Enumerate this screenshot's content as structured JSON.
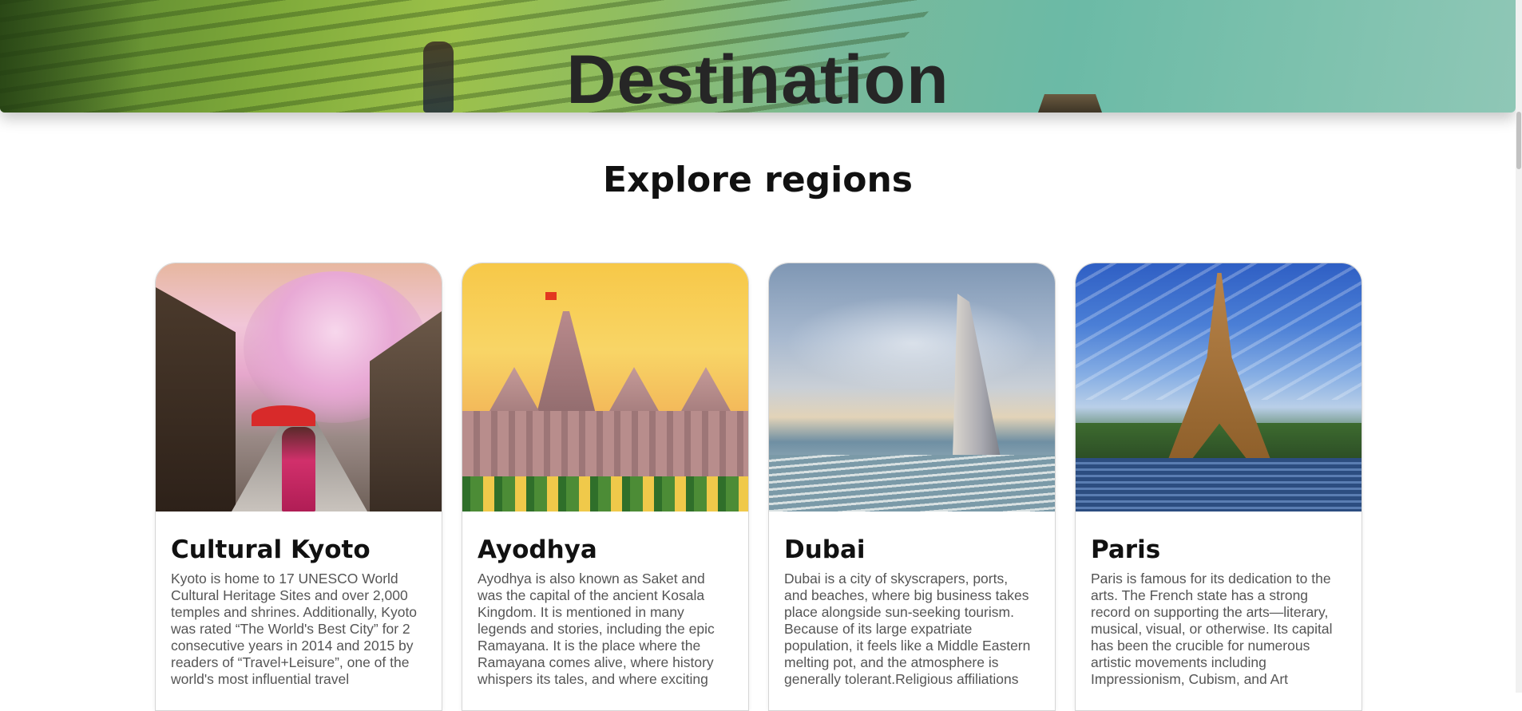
{
  "hero": {
    "title": "Destination"
  },
  "section": {
    "title": "Explore regions"
  },
  "cards": [
    {
      "title": "Cultural Kyoto",
      "image": "kyoto-street-cherry-blossom",
      "desc_lines": [
        "Kyoto is home to 17 UNESCO World",
        "Cultural Heritage Sites and over 2,000",
        "temples and shrines. Additionally, Kyoto",
        "was rated “The World's Best City” for 2",
        "consecutive years in 2014 and 2015 by",
        "readers of “Travel+Leisure”, one of the",
        "world's most influential travel"
      ]
    },
    {
      "title": "Ayodhya",
      "image": "ayodhya-ram-temple",
      "desc_lines": [
        "Ayodhya is also known as Saket and",
        "was the capital of the ancient Kosala",
        "Kingdom. It is mentioned in many",
        "legends and stories, including the epic",
        "Ramayana. It is the place where the",
        "Ramayana comes alive, where history",
        "whispers its tales, and where exciting"
      ]
    },
    {
      "title": "Dubai",
      "image": "dubai-burj-al-arab",
      "desc_lines": [
        "Dubai is a city of skyscrapers, ports,",
        "and beaches, where big business takes",
        "place alongside sun-seeking tourism.",
        "Because of its large expatriate",
        "population, it feels like a Middle Eastern",
        "melting pot, and the atmosphere is",
        "generally tolerant.Religious affiliations"
      ]
    },
    {
      "title": "Paris",
      "image": "paris-eiffel-tower",
      "desc_lines": [
        "Paris is famous for its dedication to the",
        "arts. The French state has a strong",
        "record on supporting the arts—literary,",
        "musical, visual, or otherwise. Its capital",
        "has been the crucible for numerous",
        "artistic movements including",
        "Impressionism, Cubism, and Art"
      ]
    }
  ]
}
